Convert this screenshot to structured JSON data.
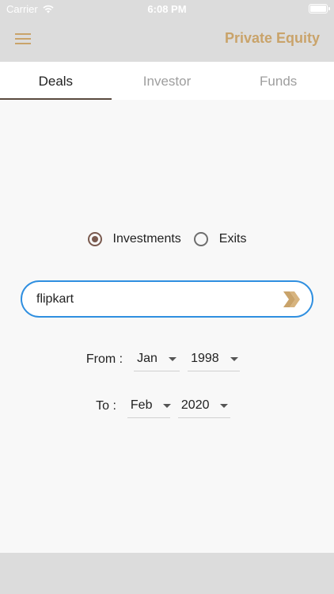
{
  "status_bar": {
    "carrier": "Carrier",
    "time": "6:08 PM"
  },
  "app_bar": {
    "title": "Private Equity",
    "accent_color": "#c9a36a"
  },
  "tabs": [
    {
      "label": "Deals",
      "active": true
    },
    {
      "label": "Investor",
      "active": false
    },
    {
      "label": "Funds",
      "active": false
    }
  ],
  "filter": {
    "options": [
      {
        "label": "Investments",
        "selected": true
      },
      {
        "label": "Exits",
        "selected": false
      }
    ]
  },
  "search": {
    "value": "flipkart",
    "focus_color": "#2f8fe0"
  },
  "from": {
    "label": "From :",
    "month": "Jan",
    "year": "1998"
  },
  "to": {
    "label": "To :",
    "month": "Feb",
    "year": "2020"
  }
}
